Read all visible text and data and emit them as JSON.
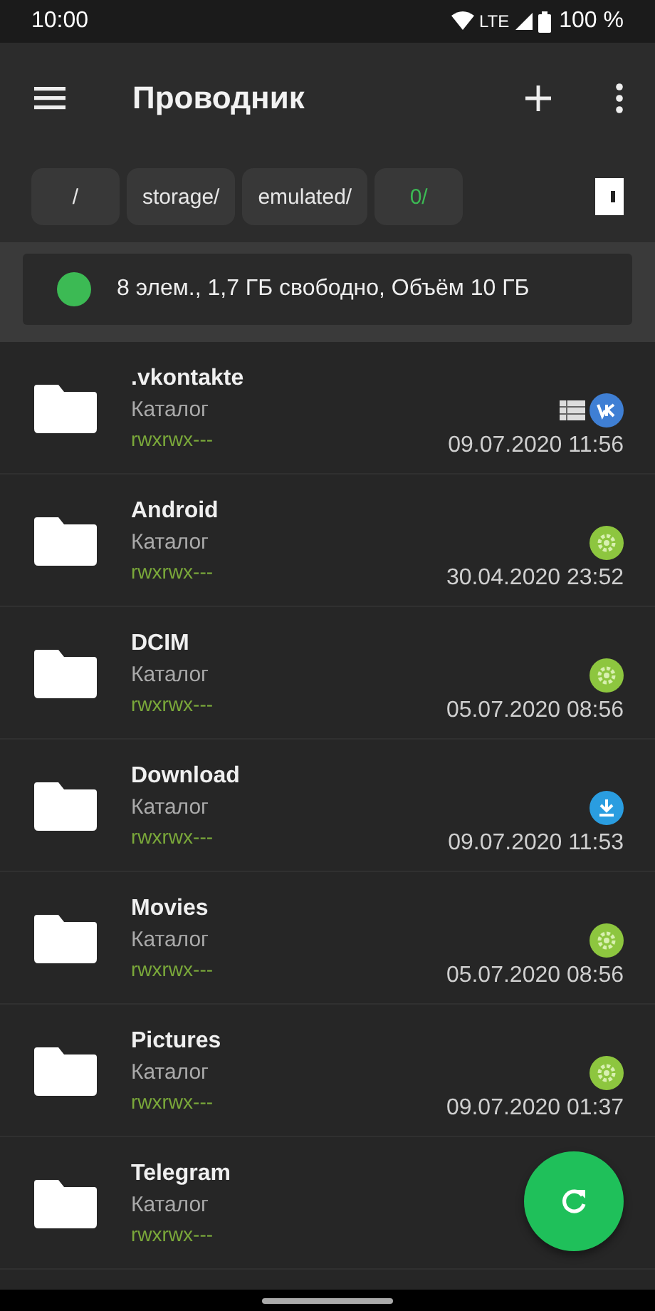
{
  "status_bar": {
    "time": "10:00",
    "network": "LTE",
    "battery": "100 %"
  },
  "toolbar": {
    "title": "Проводник"
  },
  "breadcrumbs": [
    {
      "label": "/",
      "selected": false
    },
    {
      "label": "storage/",
      "selected": false
    },
    {
      "label": "emulated/",
      "selected": false
    },
    {
      "label": "0/",
      "selected": true
    }
  ],
  "storage_info": {
    "text": "8 элем., 1,7 ГБ свободно, Объём 10 ГБ",
    "color": "#3cba54"
  },
  "files": [
    {
      "name": ".vkontakte",
      "type": "Каталог",
      "permissions": "rwxrwx---",
      "date": "09.07.2020 11:56",
      "badges": [
        {
          "kind": "list"
        },
        {
          "kind": "vk"
        }
      ]
    },
    {
      "name": "Android",
      "type": "Каталог",
      "permissions": "rwxrwx---",
      "date": "30.04.2020 23:52",
      "badges": [
        {
          "kind": "system"
        }
      ]
    },
    {
      "name": "DCIM",
      "type": "Каталог",
      "permissions": "rwxrwx---",
      "date": "05.07.2020 08:56",
      "badges": [
        {
          "kind": "system"
        }
      ]
    },
    {
      "name": "Download",
      "type": "Каталог",
      "permissions": "rwxrwx---",
      "date": "09.07.2020 11:53",
      "badges": [
        {
          "kind": "download"
        }
      ]
    },
    {
      "name": "Movies",
      "type": "Каталог",
      "permissions": "rwxrwx---",
      "date": "05.07.2020 08:56",
      "badges": [
        {
          "kind": "system"
        }
      ]
    },
    {
      "name": "Pictures",
      "type": "Каталог",
      "permissions": "rwxrwx---",
      "date": "09.07.2020 01:37",
      "badges": [
        {
          "kind": "system"
        }
      ]
    },
    {
      "name": "Telegram",
      "type": "Каталог",
      "permissions": "rwxrwx---"
    }
  ]
}
